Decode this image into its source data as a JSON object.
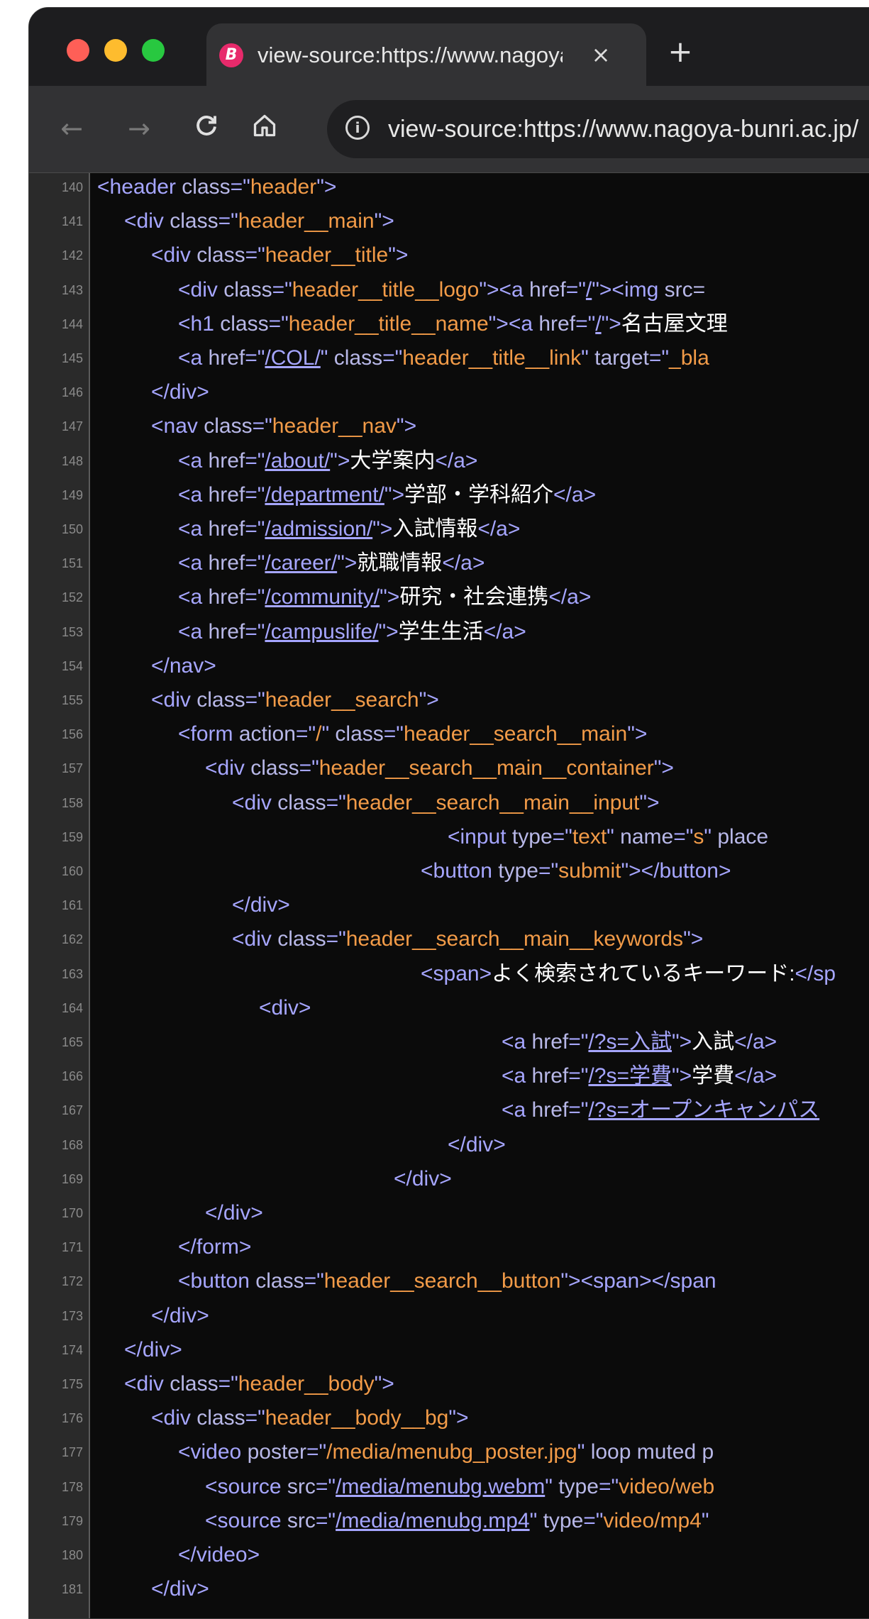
{
  "browser": {
    "tab_title": "view-source:https://www.nagoya-bunri.ac.jp/",
    "tab_favicon": "B",
    "tab_close": "×",
    "new_tab": "+",
    "url": "view-source:https://www.nagoya-bunri.ac.jp/",
    "nav": {
      "back": "←",
      "forward": "→",
      "reload": "C",
      "info": "i"
    },
    "icons": {
      "favicon": "brand-b-icon",
      "close": "close-icon",
      "home": "home-icon",
      "info": "info-icon"
    }
  },
  "source_lines": [
    {
      "n": "140",
      "indent": 0,
      "parts": [
        [
          "tag",
          "<header "
        ],
        [
          "attr",
          "class"
        ],
        [
          "tag",
          "=\""
        ],
        [
          "val",
          "header"
        ],
        [
          "tag",
          "\">"
        ]
      ]
    },
    {
      "n": "141",
      "indent": 1,
      "parts": [
        [
          "tag",
          "<div "
        ],
        [
          "attr",
          "class"
        ],
        [
          "tag",
          "=\""
        ],
        [
          "val",
          "header__main"
        ],
        [
          "tag",
          "\">"
        ]
      ]
    },
    {
      "n": "142",
      "indent": 2,
      "parts": [
        [
          "tag",
          "<div "
        ],
        [
          "attr",
          "class"
        ],
        [
          "tag",
          "=\""
        ],
        [
          "val",
          "header__title"
        ],
        [
          "tag",
          "\">"
        ]
      ]
    },
    {
      "n": "143",
      "indent": 3,
      "parts": [
        [
          "tag",
          "<div "
        ],
        [
          "attr",
          "class"
        ],
        [
          "tag",
          "=\""
        ],
        [
          "val",
          "header__title__logo"
        ],
        [
          "tag",
          "\"><a "
        ],
        [
          "attr",
          "href"
        ],
        [
          "tag",
          "=\""
        ],
        [
          "lnk",
          "/"
        ],
        [
          "tag",
          "\"><img "
        ],
        [
          "attr",
          "src="
        ]
      ]
    },
    {
      "n": "144",
      "indent": 3,
      "parts": [
        [
          "tag",
          "<h1 "
        ],
        [
          "attr",
          "class"
        ],
        [
          "tag",
          "=\""
        ],
        [
          "val",
          "header__title__name"
        ],
        [
          "tag",
          "\"><a "
        ],
        [
          "attr",
          "href"
        ],
        [
          "tag",
          "=\""
        ],
        [
          "lnk",
          "/"
        ],
        [
          "tag",
          "\">"
        ],
        [
          "txt",
          "名古屋文理"
        ]
      ]
    },
    {
      "n": "145",
      "indent": 3,
      "parts": [
        [
          "tag",
          "<a "
        ],
        [
          "attr",
          "href"
        ],
        [
          "tag",
          "=\""
        ],
        [
          "lnk",
          "/COL/"
        ],
        [
          "tag",
          "\" "
        ],
        [
          "attr",
          "class"
        ],
        [
          "tag",
          "=\""
        ],
        [
          "val",
          "header__title__link"
        ],
        [
          "tag",
          "\" "
        ],
        [
          "attr",
          "target"
        ],
        [
          "tag",
          "=\""
        ],
        [
          "val",
          "_bla"
        ]
      ]
    },
    {
      "n": "146",
      "indent": 2,
      "parts": [
        [
          "tag",
          "</div>"
        ]
      ]
    },
    {
      "n": "147",
      "indent": 2,
      "parts": [
        [
          "tag",
          "<nav "
        ],
        [
          "attr",
          "class"
        ],
        [
          "tag",
          "=\""
        ],
        [
          "val",
          "header__nav"
        ],
        [
          "tag",
          "\">"
        ]
      ]
    },
    {
      "n": "148",
      "indent": 3,
      "parts": [
        [
          "tag",
          "<a "
        ],
        [
          "attr",
          "href"
        ],
        [
          "tag",
          "=\""
        ],
        [
          "lnk",
          "/about/"
        ],
        [
          "tag",
          "\">"
        ],
        [
          "txt",
          "大学案内"
        ],
        [
          "tag",
          "</a>"
        ]
      ]
    },
    {
      "n": "149",
      "indent": 3,
      "parts": [
        [
          "tag",
          "<a "
        ],
        [
          "attr",
          "href"
        ],
        [
          "tag",
          "=\""
        ],
        [
          "lnk",
          "/department/"
        ],
        [
          "tag",
          "\">"
        ],
        [
          "txt",
          "学部・学科紹介"
        ],
        [
          "tag",
          "</a>"
        ]
      ]
    },
    {
      "n": "150",
      "indent": 3,
      "parts": [
        [
          "tag",
          "<a "
        ],
        [
          "attr",
          "href"
        ],
        [
          "tag",
          "=\""
        ],
        [
          "lnk",
          "/admission/"
        ],
        [
          "tag",
          "\">"
        ],
        [
          "txt",
          "入試情報"
        ],
        [
          "tag",
          "</a>"
        ]
      ]
    },
    {
      "n": "151",
      "indent": 3,
      "parts": [
        [
          "tag",
          "<a "
        ],
        [
          "attr",
          "href"
        ],
        [
          "tag",
          "=\""
        ],
        [
          "lnk",
          "/career/"
        ],
        [
          "tag",
          "\">"
        ],
        [
          "txt",
          "就職情報"
        ],
        [
          "tag",
          "</a>"
        ]
      ]
    },
    {
      "n": "152",
      "indent": 3,
      "parts": [
        [
          "tag",
          "<a "
        ],
        [
          "attr",
          "href"
        ],
        [
          "tag",
          "=\""
        ],
        [
          "lnk",
          "/community/"
        ],
        [
          "tag",
          "\">"
        ],
        [
          "txt",
          "研究・社会連携"
        ],
        [
          "tag",
          "</a>"
        ]
      ]
    },
    {
      "n": "153",
      "indent": 3,
      "parts": [
        [
          "tag",
          "<a "
        ],
        [
          "attr",
          "href"
        ],
        [
          "tag",
          "=\""
        ],
        [
          "lnk",
          "/campuslife/"
        ],
        [
          "tag",
          "\">"
        ],
        [
          "txt",
          "学生生活"
        ],
        [
          "tag",
          "</a>"
        ]
      ]
    },
    {
      "n": "154",
      "indent": 2,
      "parts": [
        [
          "tag",
          "</nav>"
        ]
      ]
    },
    {
      "n": "155",
      "indent": 2,
      "parts": [
        [
          "tag",
          "<div "
        ],
        [
          "attr",
          "class"
        ],
        [
          "tag",
          "=\""
        ],
        [
          "val",
          "header__search"
        ],
        [
          "tag",
          "\">"
        ]
      ]
    },
    {
      "n": "156",
      "indent": 3,
      "parts": [
        [
          "tag",
          "<form "
        ],
        [
          "attr",
          "action"
        ],
        [
          "tag",
          "=\""
        ],
        [
          "val",
          "/"
        ],
        [
          "tag",
          "\" "
        ],
        [
          "attr",
          "class"
        ],
        [
          "tag",
          "=\""
        ],
        [
          "val",
          "header__search__main"
        ],
        [
          "tag",
          "\">"
        ]
      ]
    },
    {
      "n": "157",
      "indent": 4,
      "parts": [
        [
          "tag",
          "<div "
        ],
        [
          "attr",
          "class"
        ],
        [
          "tag",
          "=\""
        ],
        [
          "val",
          "header__search__main__container"
        ],
        [
          "tag",
          "\">"
        ]
      ]
    },
    {
      "n": "158",
      "indent": 5,
      "parts": [
        [
          "tag",
          "<div "
        ],
        [
          "attr",
          "class"
        ],
        [
          "tag",
          "=\""
        ],
        [
          "val",
          "header__search__main__input"
        ],
        [
          "tag",
          "\">"
        ]
      ]
    },
    {
      "n": "159",
      "indent": 13,
      "parts": [
        [
          "tag",
          "<input "
        ],
        [
          "attr",
          "type"
        ],
        [
          "tag",
          "=\""
        ],
        [
          "val",
          "text"
        ],
        [
          "tag",
          "\" "
        ],
        [
          "attr",
          "name"
        ],
        [
          "tag",
          "=\""
        ],
        [
          "val",
          "s"
        ],
        [
          "tag",
          "\" "
        ],
        [
          "attr",
          "place"
        ]
      ]
    },
    {
      "n": "160",
      "indent": 12,
      "parts": [
        [
          "tag",
          "<button "
        ],
        [
          "attr",
          "type"
        ],
        [
          "tag",
          "=\""
        ],
        [
          "val",
          "submit"
        ],
        [
          "tag",
          "\"></button>"
        ]
      ]
    },
    {
      "n": "161",
      "indent": 5,
      "parts": [
        [
          "tag",
          "</div>"
        ]
      ]
    },
    {
      "n": "162",
      "indent": 5,
      "parts": [
        [
          "tag",
          "<div "
        ],
        [
          "attr",
          "class"
        ],
        [
          "tag",
          "=\""
        ],
        [
          "val",
          "header__search__main__keywords"
        ],
        [
          "tag",
          "\">"
        ]
      ]
    },
    {
      "n": "163",
      "indent": 12,
      "parts": [
        [
          "tag",
          "<span>"
        ],
        [
          "txt",
          "よく検索されているキーワード:"
        ],
        [
          "tag",
          "</sp"
        ]
      ]
    },
    {
      "n": "164",
      "indent": 6,
      "parts": [
        [
          "tag",
          "<div>"
        ]
      ]
    },
    {
      "n": "165",
      "indent": 15,
      "parts": [
        [
          "tag",
          "<a "
        ],
        [
          "attr",
          "href"
        ],
        [
          "tag",
          "=\""
        ],
        [
          "lnk",
          "/?s=入試"
        ],
        [
          "tag",
          "\">"
        ],
        [
          "txt",
          "入試"
        ],
        [
          "tag",
          "</a>"
        ]
      ]
    },
    {
      "n": "166",
      "indent": 15,
      "parts": [
        [
          "tag",
          "<a "
        ],
        [
          "attr",
          "href"
        ],
        [
          "tag",
          "=\""
        ],
        [
          "lnk",
          "/?s=学費"
        ],
        [
          "tag",
          "\">"
        ],
        [
          "txt",
          "学費"
        ],
        [
          "tag",
          "</a>"
        ]
      ]
    },
    {
      "n": "167",
      "indent": 15,
      "parts": [
        [
          "tag",
          "<a "
        ],
        [
          "attr",
          "href"
        ],
        [
          "tag",
          "=\""
        ],
        [
          "lnk",
          "/?s=オープンキャンパス"
        ]
      ]
    },
    {
      "n": "168",
      "indent": 13,
      "parts": [
        [
          "tag",
          "</div>"
        ]
      ]
    },
    {
      "n": "169",
      "indent": 11,
      "parts": [
        [
          "tag",
          "</div>"
        ]
      ]
    },
    {
      "n": "170",
      "indent": 4,
      "parts": [
        [
          "tag",
          "</div>"
        ]
      ]
    },
    {
      "n": "171",
      "indent": 3,
      "parts": [
        [
          "tag",
          "</form>"
        ]
      ]
    },
    {
      "n": "172",
      "indent": 3,
      "parts": [
        [
          "tag",
          "<button "
        ],
        [
          "attr",
          "class"
        ],
        [
          "tag",
          "=\""
        ],
        [
          "val",
          "header__search__button"
        ],
        [
          "tag",
          "\"><span></span"
        ]
      ]
    },
    {
      "n": "173",
      "indent": 2,
      "parts": [
        [
          "tag",
          "</div>"
        ]
      ]
    },
    {
      "n": "174",
      "indent": 1,
      "parts": [
        [
          "tag",
          "</div>"
        ]
      ]
    },
    {
      "n": "175",
      "indent": 1,
      "parts": [
        [
          "tag",
          "<div "
        ],
        [
          "attr",
          "class"
        ],
        [
          "tag",
          "=\""
        ],
        [
          "val",
          "header__body"
        ],
        [
          "tag",
          "\">"
        ]
      ]
    },
    {
      "n": "176",
      "indent": 2,
      "parts": [
        [
          "tag",
          "<div "
        ],
        [
          "attr",
          "class"
        ],
        [
          "tag",
          "=\""
        ],
        [
          "val",
          "header__body__bg"
        ],
        [
          "tag",
          "\">"
        ]
      ]
    },
    {
      "n": "177",
      "indent": 3,
      "parts": [
        [
          "tag",
          "<video "
        ],
        [
          "attr",
          "poster"
        ],
        [
          "tag",
          "=\""
        ],
        [
          "val",
          "/media/menubg_poster.jpg"
        ],
        [
          "tag",
          "\" "
        ],
        [
          "attr",
          "loop muted p"
        ]
      ]
    },
    {
      "n": "178",
      "indent": 4,
      "parts": [
        [
          "tag",
          "<source "
        ],
        [
          "attr",
          "src"
        ],
        [
          "tag",
          "=\""
        ],
        [
          "lnk",
          "/media/menubg.webm"
        ],
        [
          "tag",
          "\" "
        ],
        [
          "attr",
          "type"
        ],
        [
          "tag",
          "=\""
        ],
        [
          "val",
          "video/web"
        ]
      ]
    },
    {
      "n": "179",
      "indent": 4,
      "parts": [
        [
          "tag",
          "<source "
        ],
        [
          "attr",
          "src"
        ],
        [
          "tag",
          "=\""
        ],
        [
          "lnk",
          "/media/menubg.mp4"
        ],
        [
          "tag",
          "\" "
        ],
        [
          "attr",
          "type"
        ],
        [
          "tag",
          "=\""
        ],
        [
          "val",
          "video/mp4"
        ],
        [
          "tag",
          "\""
        ]
      ]
    },
    {
      "n": "180",
      "indent": 3,
      "parts": [
        [
          "tag",
          "</video>"
        ]
      ]
    },
    {
      "n": "181",
      "indent": 2,
      "parts": [
        [
          "tag",
          "</div>"
        ]
      ]
    }
  ]
}
